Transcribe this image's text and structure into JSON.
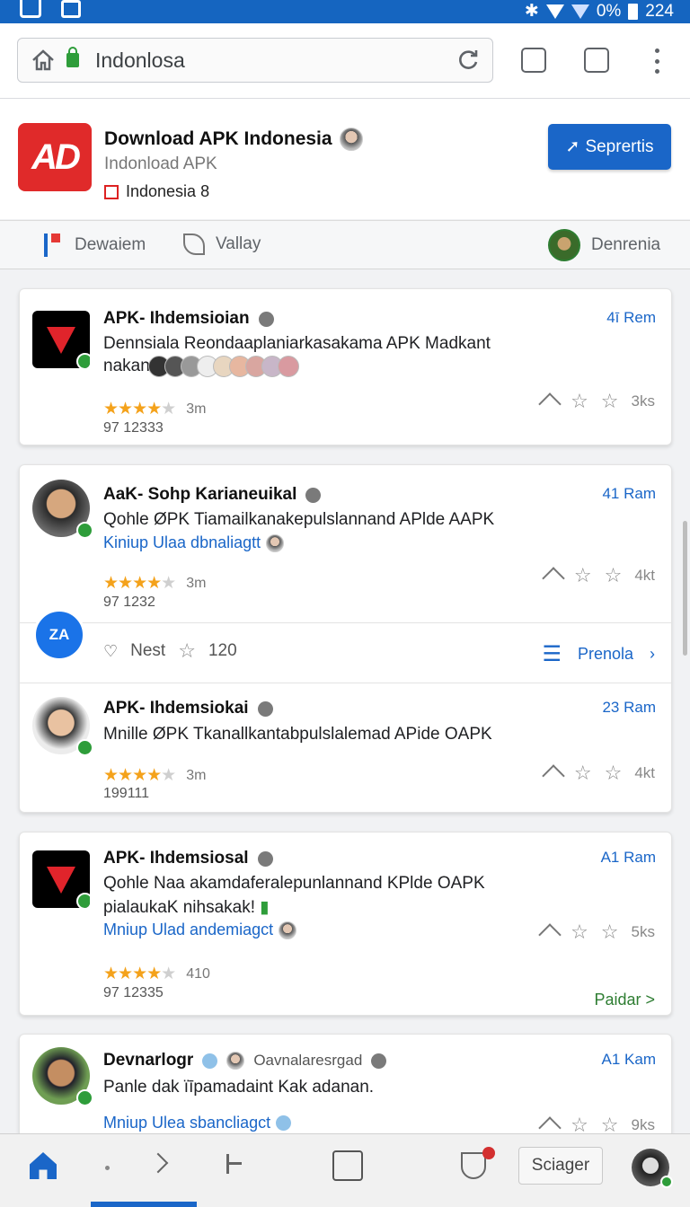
{
  "status_bar": {
    "battery": "0%",
    "time": "224"
  },
  "browser": {
    "url": "Indonlosa"
  },
  "app_header": {
    "title": "Download APK Indonesia",
    "subtitle": "Indonload APK",
    "country": "Indonesia 8",
    "logo_text": "AD",
    "primary_button": "Seprertis"
  },
  "sub_nav": {
    "item1": "Dewaiem",
    "item2": "Vallay",
    "item3": "Denrenia"
  },
  "cards": [
    {
      "title": "APK- Ihdemsioian",
      "rank": "4ī Rem",
      "desc1": "Dennsiala Reondaaplaniarkasakama APK Madkant",
      "desc2": "nakan",
      "rating_text": "3m",
      "count": "97 12333",
      "actions_text": "3ks"
    },
    {
      "title": "AaK- Sohp Karianeuikal",
      "rank": "41 Ram",
      "desc1": "Qohle ØPK Tiamailkanakepulslannand APlde AAPK",
      "link": "Kiniup Ulaa dbnaliagtt",
      "rating_text": "3m",
      "count": "97 1232",
      "actions_text": "4kt"
    },
    {
      "promo_logo": "ZA",
      "nest_label": "Nest",
      "star_count": "120",
      "promo_link": "Prenola"
    },
    {
      "title": "APK- Ihdemsiokai",
      "rank": "23 Ram",
      "desc1": "Mnille ØPK Tkanallkantabpulslalemad APide OAPK",
      "rating_text": "3m",
      "count": "199111",
      "actions_text": "4kt"
    },
    {
      "title": "APK- Ihdemsiosal",
      "rank": "A1 Ram",
      "desc1": "Qohle Naa akamdaferalepunlannand KPlde OAPK",
      "desc2": "pialaukaK nihsakak!",
      "link": "Mniup Ulad andemiagct",
      "rating_text": "410",
      "count": "97 12335",
      "actions_text": "5ks",
      "green_link": "Paidar >"
    },
    {
      "title": "Devnarlogr",
      "title_extra": "Oavnalaresrgad",
      "rank": "A1 Kam",
      "desc1": "Panle dak ïīpamadaint Kak adanan.",
      "link": "Mniup Ulea sbancliagct",
      "actions_text": "9ks"
    }
  ],
  "bottom_nav": {
    "button": "Sciager"
  },
  "colors": {
    "accent": "#1a66c8",
    "status_bar": "#1565c0",
    "verified": "#2e9d3a",
    "star": "#f4a21b"
  }
}
